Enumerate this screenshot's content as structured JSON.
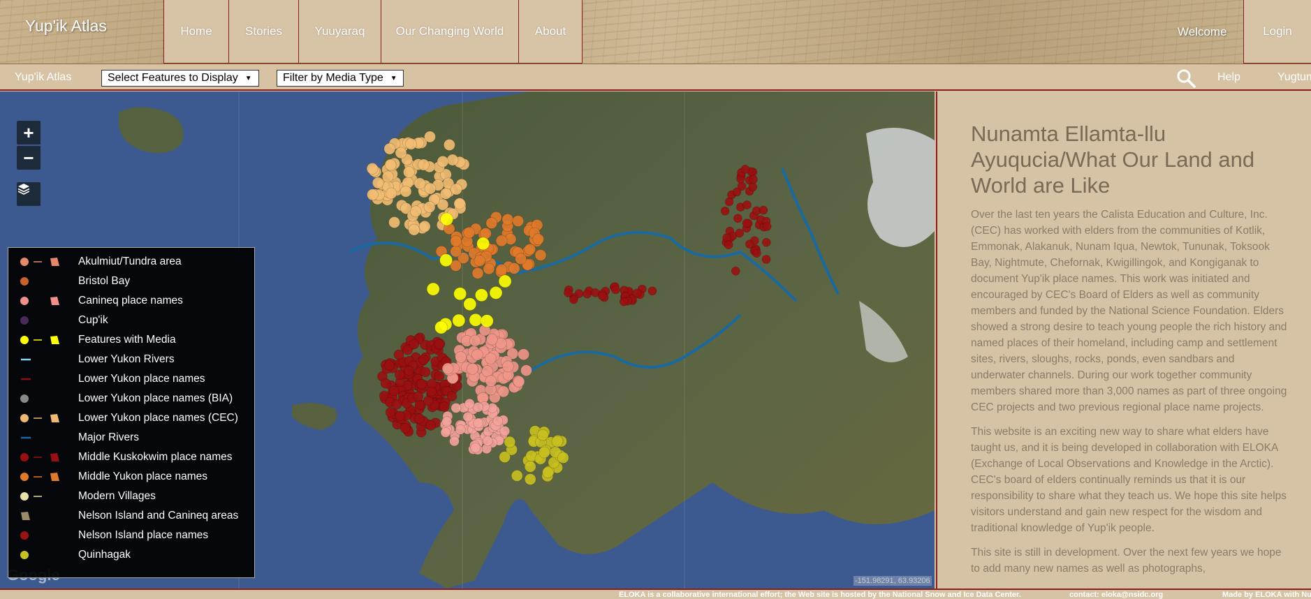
{
  "header": {
    "logo": "Yup'ik Atlas",
    "nav": [
      {
        "label": "Home"
      },
      {
        "label": "Stories"
      },
      {
        "label": "Yuuyaraq"
      },
      {
        "label": "Our Changing World"
      },
      {
        "label": "About"
      }
    ],
    "welcome": "Welcome",
    "login": "Login"
  },
  "toolbar": {
    "title": "Yup'ik Atlas",
    "features_dropdown": "Select Features to Display",
    "media_dropdown": "Filter by Media Type",
    "help": "Help",
    "language": "Yugtun"
  },
  "map": {
    "zoom_in": "+",
    "zoom_out": "−",
    "layers_icon": "layers-icon",
    "coordinates": "-151.98291, 63.93206",
    "attribution": "Google"
  },
  "legend": [
    {
      "label": "Akulmiut/Tundra area",
      "color": "#e8886a",
      "symbols": [
        "point",
        "line",
        "polygon"
      ]
    },
    {
      "label": "Bristol Bay",
      "color": "#c8622a",
      "symbols": [
        "point"
      ]
    },
    {
      "label": "Canineq place names",
      "color": "#f0908a",
      "symbols": [
        "point",
        "polygon"
      ]
    },
    {
      "label": "Cup'ik",
      "color": "#4a2a5a",
      "symbols": [
        "point"
      ]
    },
    {
      "label": "Features with Media",
      "color": "#ffff00",
      "symbols": [
        "point",
        "line",
        "polygon"
      ]
    },
    {
      "label": "Lower Yukon Rivers",
      "color": "#8ad0f0",
      "symbols": [
        "line"
      ]
    },
    {
      "label": "Lower Yukon place names",
      "color": "#8a1010",
      "symbols": [
        "line"
      ]
    },
    {
      "label": "Lower Yukon place names (BIA)",
      "color": "#888888",
      "symbols": [
        "point"
      ]
    },
    {
      "label": "Lower Yukon place names (CEC)",
      "color": "#f0b870",
      "symbols": [
        "point",
        "line",
        "polygon"
      ]
    },
    {
      "label": "Major Rivers",
      "color": "#1a6aa0",
      "symbols": [
        "line"
      ]
    },
    {
      "label": "Middle Kuskokwim place names",
      "color": "#9a1010",
      "symbols": [
        "point",
        "line",
        "polygon"
      ]
    },
    {
      "label": "Middle Yukon place names",
      "color": "#e07a2a",
      "symbols": [
        "point",
        "line",
        "polygon"
      ]
    },
    {
      "label": "Modern Villages",
      "color": "#e8e2a8",
      "symbols": [
        "point",
        "line"
      ]
    },
    {
      "label": "Nelson Island and Canineq areas",
      "color": "#9a8a6a",
      "symbols": [
        "polygon"
      ]
    },
    {
      "label": "Nelson Island place names",
      "color": "#9a1414",
      "symbols": [
        "point"
      ]
    },
    {
      "label": "Quinhagak",
      "color": "#c8c020",
      "symbols": [
        "point"
      ]
    }
  ],
  "panel": {
    "title": "Nunamta Ellamta-llu Ayuqucia/What Our Land and World are Like",
    "paragraphs": [
      "Over the last ten years the Calista Education and Culture, Inc. (CEC) has worked with elders from the communities of Kotlik, Emmonak, Alakanuk, Nunam Iqua, Newtok, Tununak, Toksook Bay, Nightmute, Chefornak, Kwigillingok, and Kongiganak to document Yup'ik place names. This work was initiated and encouraged by CEC's Board of Elders as well as community members and funded by the National Science Foundation. Elders showed a strong desire to teach young people the rich history and named places of their homeland, including camp and settlement sites, rivers, sloughs, rocks, ponds, even sandbars and underwater channels. During our work together community members shared more than 3,000 names as part of three ongoing CEC projects and two previous regional place name projects.",
      "This website is an exciting new way to share what elders have taught us, and it is being developed in collaboration with ELOKA (Exchange of Local Observations and Knowledge in the Arctic). CEC's board of elders continually reminds us that it is our responsibility to share what they teach us. We hope this site helps visitors understand and gain new respect for the wisdom and traditional knowledge of Yup'ik people.",
      "This site is still in development. Over the next few years we hope to add many new names as well as photographs,"
    ]
  },
  "footer": {
    "hosting": "ELOKA is a collaborative international effort; the Web site is hosted by the National Snow and Ice Data Center.",
    "contact": "contact: eloka@nsidc.org",
    "made_by": "Made by ELOKA with Nunalit"
  }
}
